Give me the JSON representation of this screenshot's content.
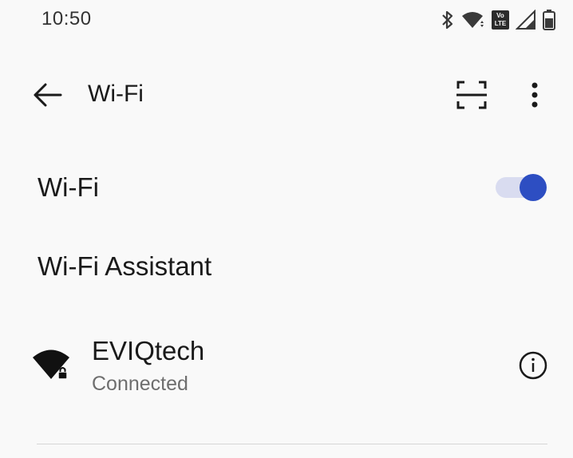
{
  "status_bar": {
    "time": "10:50",
    "volte_label_top": "Vo",
    "volte_label_bottom": "LTE",
    "icons": [
      "bluetooth-icon",
      "wifi-status-icon",
      "volte-icon",
      "cell-signal-icon",
      "battery-icon"
    ]
  },
  "app_bar": {
    "title": "Wi-Fi",
    "back_icon": "arrow-left-icon",
    "scan_icon": "qr-scan-icon",
    "more_icon": "more-vert-icon"
  },
  "wifi_toggle_row": {
    "label": "Wi-Fi",
    "enabled": true,
    "accent_color": "#2d4ec2",
    "track_color": "#d9dcf0"
  },
  "assistant_row": {
    "label": "Wi-Fi Assistant"
  },
  "network": {
    "name": "EVIQtech",
    "status": "Connected",
    "secured": true,
    "icon": "wifi-locked-icon",
    "info_icon": "info-icon"
  }
}
